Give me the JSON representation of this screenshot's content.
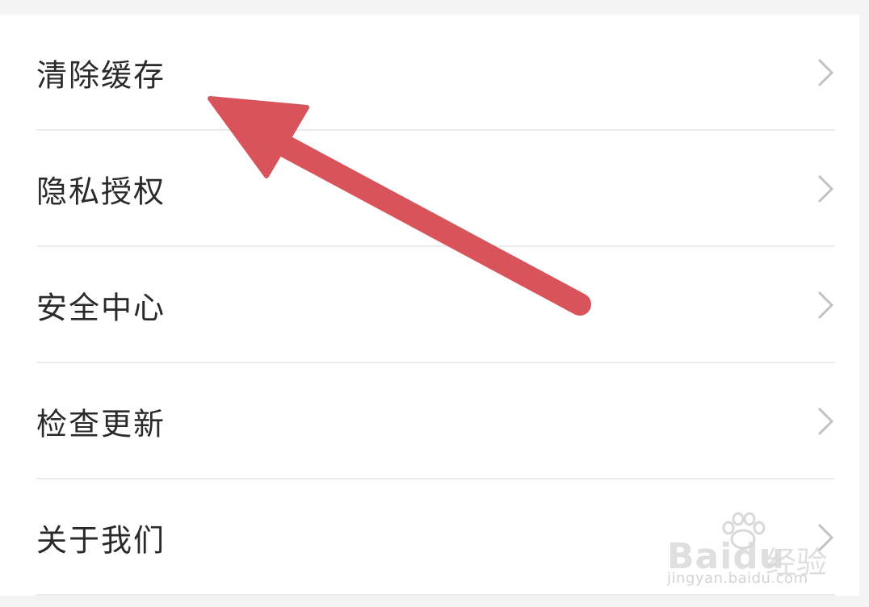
{
  "settings": {
    "items": [
      {
        "label": "清除缓存",
        "icon": "chevron-right-icon"
      },
      {
        "label": "隐私授权",
        "icon": "chevron-right-icon"
      },
      {
        "label": "安全中心",
        "icon": "chevron-right-icon"
      },
      {
        "label": "检查更新",
        "icon": "chevron-right-icon"
      },
      {
        "label": "关于我们",
        "icon": "chevron-right-icon"
      }
    ]
  },
  "annotation": {
    "icon": "arrow-pointer-icon",
    "color": "#d9535b"
  },
  "watermark": {
    "brand": "Baidu",
    "brand_cn": "经验",
    "url": "jingyan.baidu.com"
  },
  "colors": {
    "text": "#2a2a2a",
    "divider": "#ececec",
    "chevron": "#c2c2c2",
    "background": "#ffffff",
    "page_bg": "#f3f3f3"
  }
}
